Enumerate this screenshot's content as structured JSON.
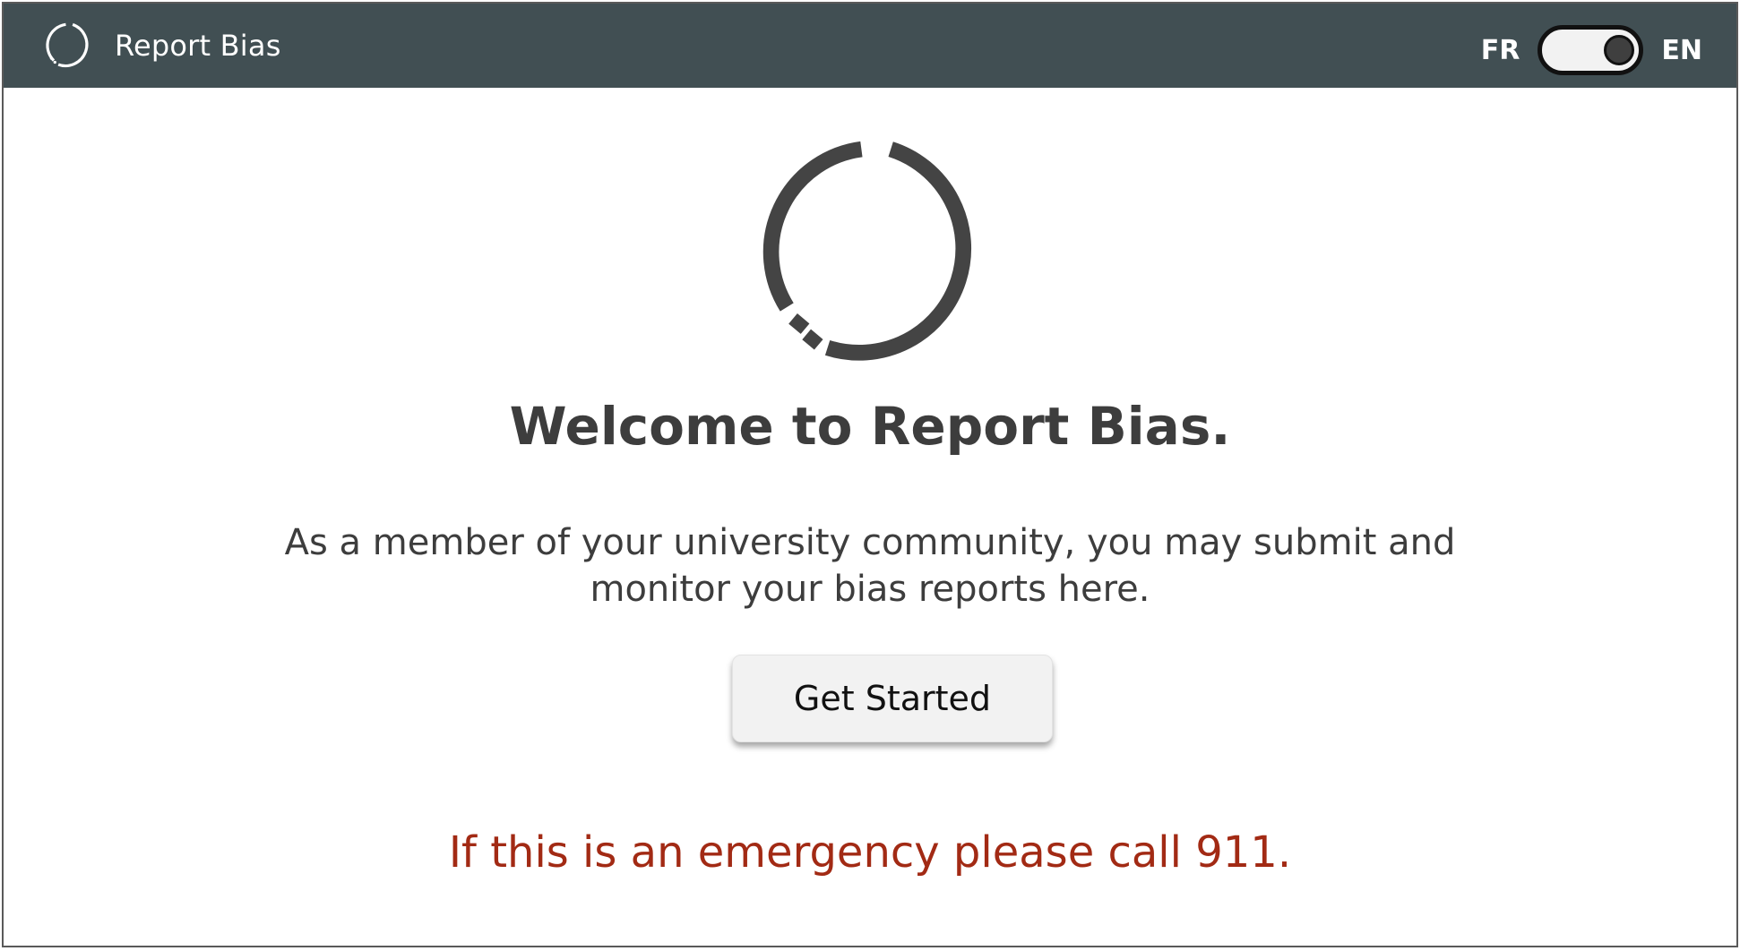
{
  "header": {
    "title": "Report Bias",
    "logo_icon": "ring-logo-icon",
    "bar_color": "#414f53"
  },
  "language": {
    "left_label": "FR",
    "right_label": "EN",
    "selected": "EN"
  },
  "main": {
    "logo_icon": "ring-logo-icon",
    "welcome_prefix": "Welcome to ",
    "welcome_brand": "Report Bias",
    "welcome_suffix": ".",
    "description": "As a member of your university community, you may submit and monitor your bias reports here.",
    "cta_label": "Get Started",
    "emergency_text": "If this is an emergency please call 911.",
    "emergency_color": "#a22a14"
  }
}
